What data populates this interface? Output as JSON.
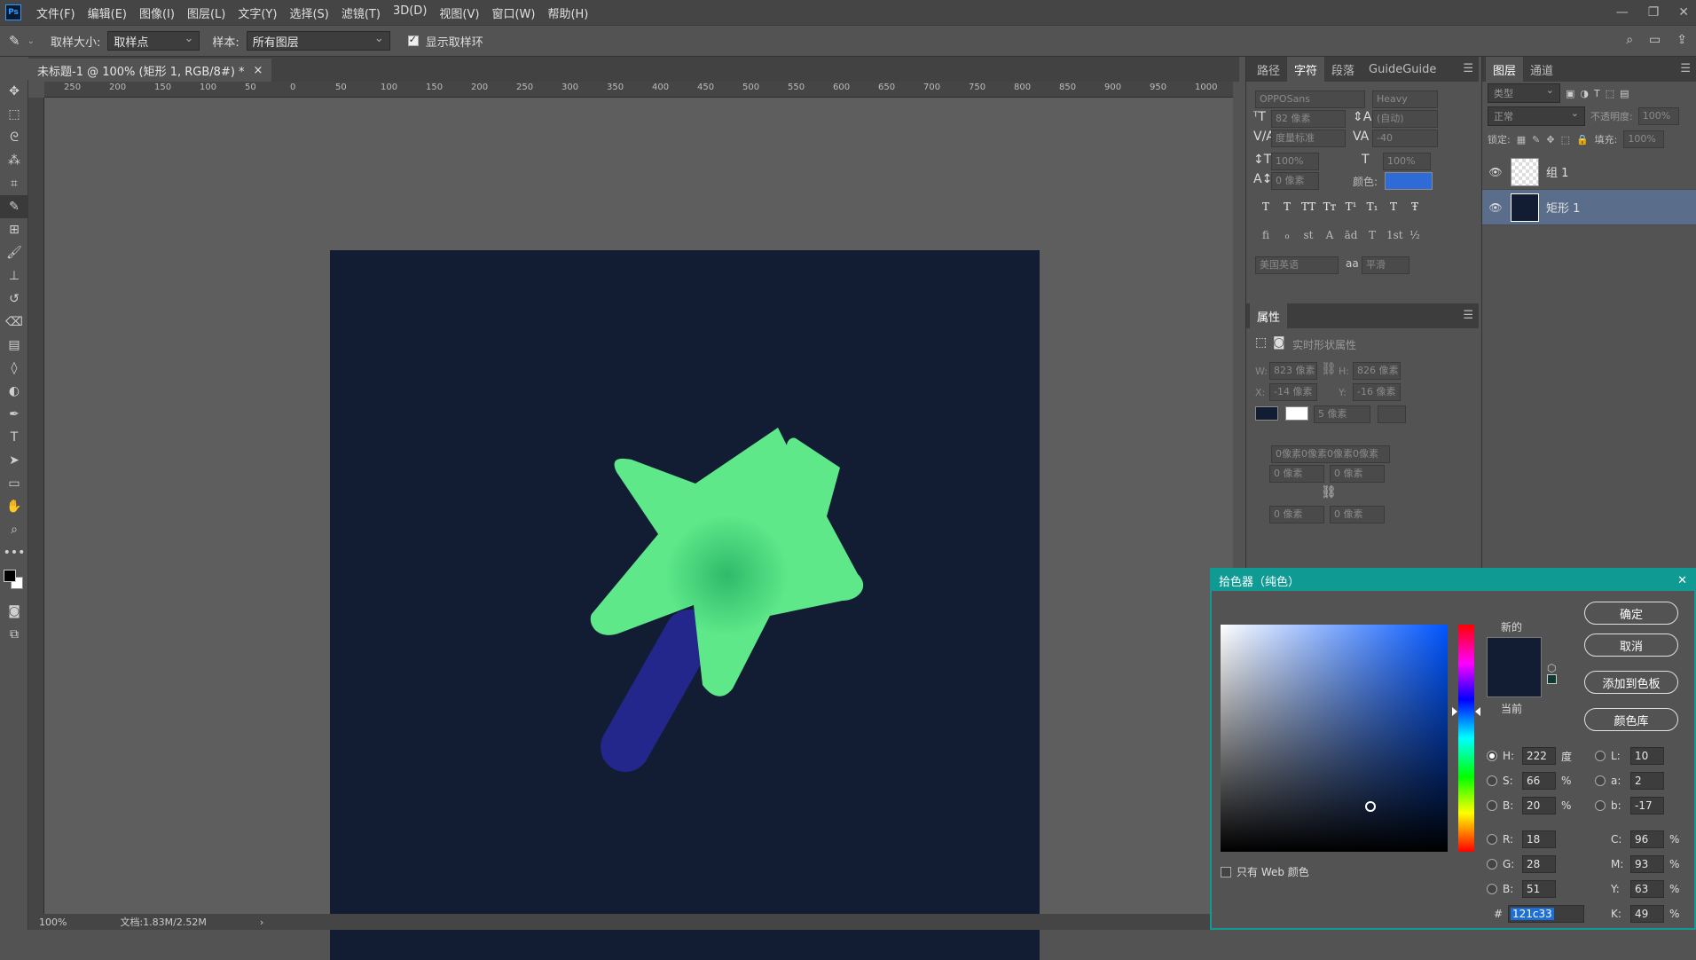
{
  "menubar": {
    "logo": "Ps",
    "items": [
      "文件(F)",
      "编辑(E)",
      "图像(I)",
      "图层(L)",
      "文字(Y)",
      "选择(S)",
      "滤镜(T)",
      "3D(D)",
      "视图(V)",
      "窗口(W)",
      "帮助(H)"
    ]
  },
  "options": {
    "sample_size_label": "取样大小:",
    "sample_size_value": "取样点",
    "sample_label": "样本:",
    "sample_value": "所有图层",
    "show_ring_label": "显示取样环",
    "show_ring_checked": true
  },
  "document": {
    "tab_title": "未标题-1 @ 100% (矩形 1, RGB/8#) *",
    "close": "×",
    "ruler_labels": [
      "250",
      "200",
      "150",
      "100",
      "50",
      "0",
      "50",
      "100",
      "150",
      "200",
      "250",
      "300",
      "350",
      "400",
      "450",
      "500",
      "550",
      "600",
      "650",
      "700",
      "750",
      "800",
      "850",
      "900",
      "950",
      "1000",
      "105"
    ],
    "zoom": "100%",
    "doc_size": "文档:1.83M/2.52M",
    "background_color": "#121c33",
    "star_color": "#5ee88a",
    "star_center_color": "#2fba6a",
    "stick_color": "#23268a"
  },
  "character_panel": {
    "tabs": [
      "路径",
      "字符",
      "段落",
      "GuideGuide"
    ],
    "active_tab": "字符",
    "font_family": "OPPOSans",
    "font_style": "Heavy",
    "font_size": "82 像素",
    "leading": "(自动)",
    "kerning": "度量标准",
    "tracking": "-40",
    "vscale": "100%",
    "hscale": "100%",
    "baseline": "0 像素",
    "color_label": "颜色:",
    "color_value": "#2f6bd6",
    "language": "美国英语",
    "aa_label": "aa",
    "antialias": "平滑",
    "style_buttons": [
      "T",
      "T",
      "TT",
      "Tт",
      "T¹",
      "T₁",
      "T",
      "Ŧ"
    ],
    "opentype_buttons": [
      "fi",
      "ℴ",
      "st",
      "A",
      "ād",
      "T",
      "1st",
      "½"
    ]
  },
  "properties_panel": {
    "title": "属性",
    "subtitle": "实时形状属性",
    "w_label": "W:",
    "w_value": "823 像素",
    "h_label": "H:",
    "h_value": "826 像素",
    "x_label": "X:",
    "x_value": "-14 像素",
    "y_label": "Y:",
    "y_value": "-16 像素",
    "stroke_size": "5 像素",
    "radius_all": "0像素0像素0像素0像素",
    "radius_tl": "0 像素",
    "radius_tr": "0 像素",
    "radius_bl": "0 像素",
    "radius_br": "0 像素"
  },
  "layers_panel": {
    "tabs": [
      "图层",
      "通道"
    ],
    "filter_label": "类型",
    "blend_mode": "正常",
    "opacity_label": "不透明度:",
    "opacity_value": "100%",
    "lock_label": "锁定:",
    "fill_label": "填充:",
    "fill_value": "100%",
    "layers": [
      {
        "name": "组 1",
        "selected": false
      },
      {
        "name": "矩形 1",
        "selected": true
      }
    ]
  },
  "color_picker": {
    "title": "拾色器（纯色）",
    "new_label": "新的",
    "current_label": "当前",
    "ok_label": "确定",
    "cancel_label": "取消",
    "add_swatch_label": "添加到色板",
    "library_label": "颜色库",
    "web_only_label": "只有 Web 颜色",
    "H": "222",
    "H_unit": "度",
    "S": "66",
    "S_unit": "%",
    "B": "20",
    "B_unit": "%",
    "R": "18",
    "G": "28",
    "Bl": "51",
    "L": "10",
    "a": "2",
    "b": "-17",
    "C": "96",
    "M": "93",
    "Y": "63",
    "K": "49",
    "pct": "%",
    "hash": "#",
    "hex": "121c33",
    "selected_color": "#121c33",
    "hue_fraction": 0.383,
    "saturation_fraction": 0.66,
    "brightness_fraction": 0.2
  }
}
